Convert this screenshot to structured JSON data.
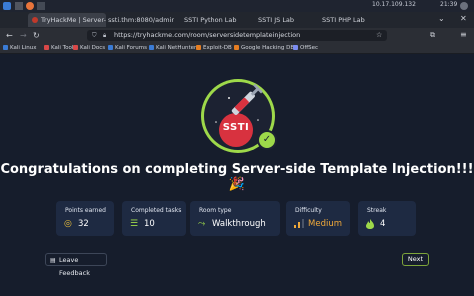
{
  "system_bar": {
    "ip": "10.17.109.132",
    "time": "21:39"
  },
  "tabs": [
    {
      "label": "TryHackMe | Server-",
      "active": true
    },
    {
      "label": "ssti.thm:8080/admin/fo",
      "active": false
    },
    {
      "label": "SSTI Python Lab",
      "active": false
    },
    {
      "label": "SSTI JS Lab",
      "active": false
    },
    {
      "label": "SSTI PHP Lab",
      "active": false
    }
  ],
  "address_bar": {
    "url": "https://tryhackme.com/room/serversidetemplateinjection"
  },
  "bookmarks": [
    {
      "label": "Kali Linux"
    },
    {
      "label": "Kali Tools"
    },
    {
      "label": "Kali Docs"
    },
    {
      "label": "Kali Forums"
    },
    {
      "label": "Kali NetHunter"
    },
    {
      "label": "Exploit-DB"
    },
    {
      "label": "Google Hacking DB"
    },
    {
      "label": "OffSec"
    }
  ],
  "badge": {
    "text": "SSTI"
  },
  "heading": "Congratulations on completing Server-side Template Injection!!! 🎉",
  "stats": [
    {
      "label": "Points earned",
      "value": "32",
      "icon": "target-icon",
      "color": "#f0c23a"
    },
    {
      "label": "Completed tasks",
      "value": "10",
      "icon": "list-icon",
      "color": "#9ed94a"
    },
    {
      "label": "Room type",
      "value": "Walkthrough",
      "icon": "route-icon",
      "color": "#9ed94a"
    },
    {
      "label": "Difficulty",
      "value": "Medium",
      "icon": "signal-icon",
      "color": "#f0a93a"
    },
    {
      "label": "Streak",
      "value": "4",
      "icon": "flame-icon",
      "color": "#9ed94a"
    }
  ],
  "actions": {
    "feedback": "Leave Feedback",
    "next": "Next"
  },
  "colors": {
    "accent_green": "#9ed94a",
    "badge_red": "#d8323f",
    "card_bg": "#1e2a42",
    "page_bg": "#161d2c"
  }
}
